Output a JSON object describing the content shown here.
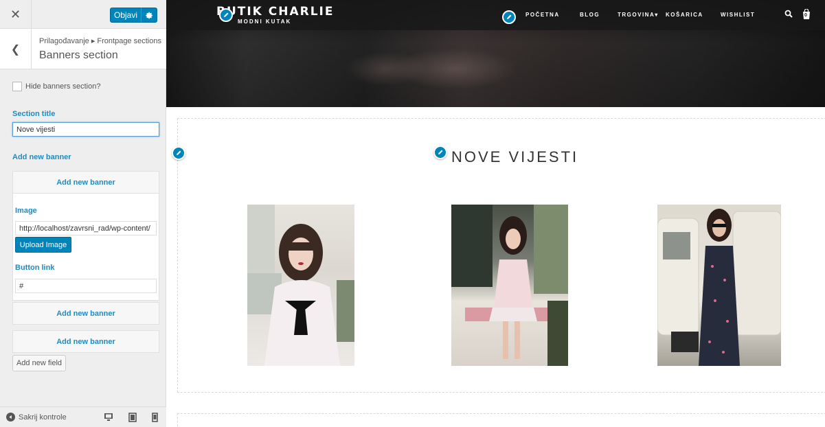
{
  "sidebar": {
    "close_icon": "close-icon",
    "publish_label": "Objavi",
    "breadcrumb": "Prilagođavanje ▸ Frontpage sections",
    "section_title": "Banners section",
    "hide_checkbox_label": "Hide banners section?",
    "hide_checked": false,
    "section_title_label": "Section title",
    "section_title_value": "Nove vijesti",
    "add_new_banner_heading": "Add new banner",
    "banners": [
      {
        "label": "Add new banner"
      },
      {
        "label": "Add new banner"
      },
      {
        "label": "Add new banner"
      }
    ],
    "image_label": "Image",
    "image_url": "http://localhost/zavrsni_rad/wp-content/",
    "upload_label": "Upload Image",
    "button_link_label": "Button link",
    "button_link_value": "#",
    "add_field_label": "Add new field",
    "footer_label": "Sakrij kontrole"
  },
  "preview": {
    "site_title": "BUTIK CHARLIE",
    "site_tagline": "MODNI KUTAK",
    "nav": [
      "POČETNA",
      "BLOG",
      "TRGOVINA",
      "KOŠARICA",
      "WISHLIST"
    ],
    "nav_dropdown_marker": "▾",
    "cart_count": "0",
    "section_heading": "NOVE VIJESTI"
  },
  "colors": {
    "accent": "#0085ba",
    "link_blue": "#1e8cbe"
  }
}
